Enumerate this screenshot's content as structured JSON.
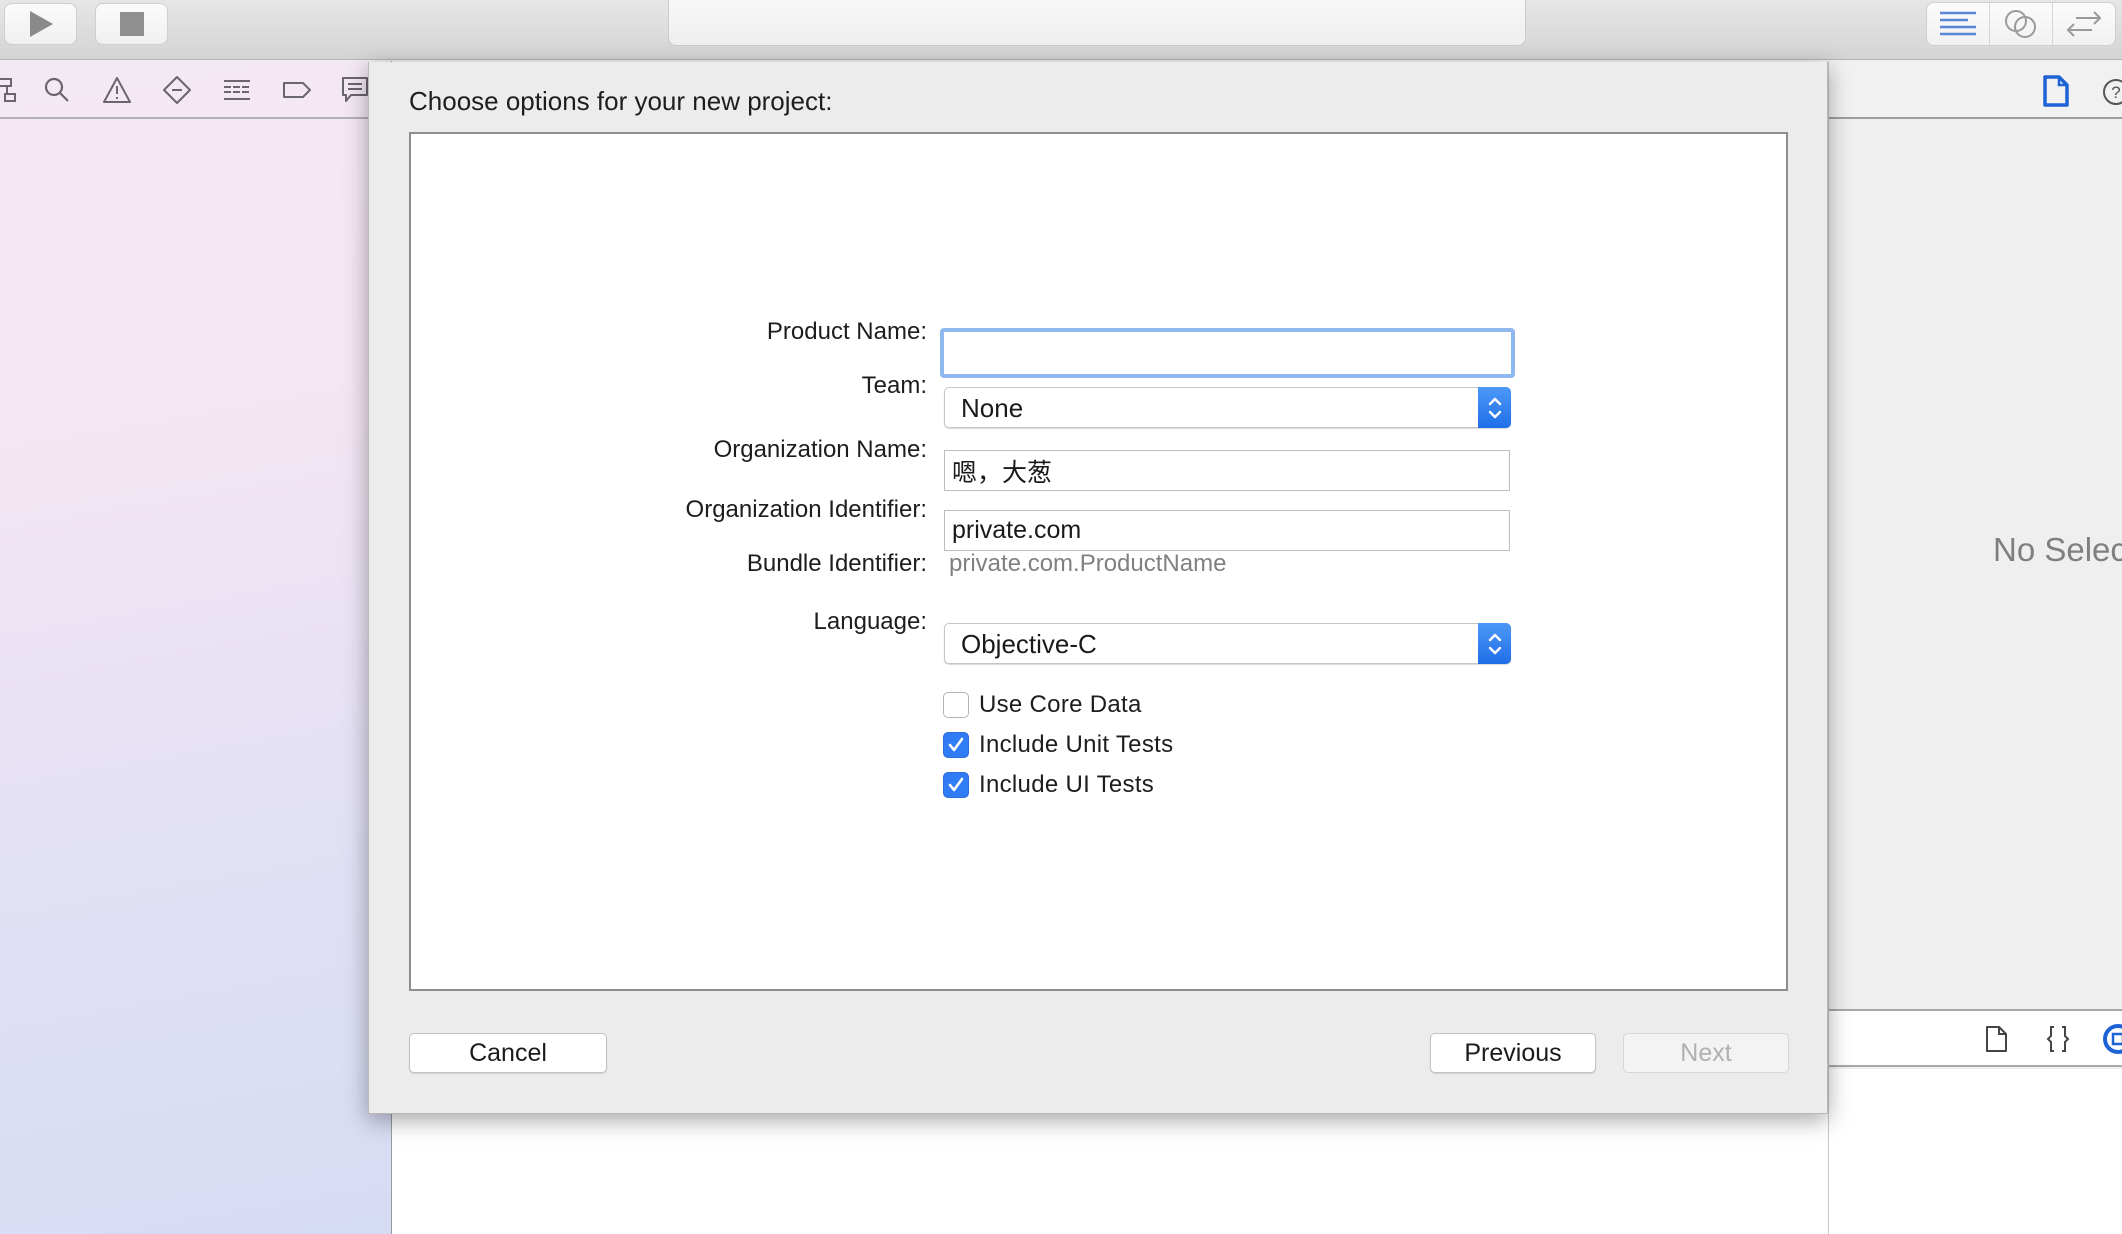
{
  "toolbar": {
    "run_icon": "play-icon",
    "stop_icon": "stop-icon",
    "activity_text": "",
    "editor_modes": [
      {
        "name": "standard-editor",
        "icon": "lines-icon",
        "active": true
      },
      {
        "name": "assistant-editor",
        "icon": "overlapping-circles-icon",
        "active": false
      },
      {
        "name": "version-editor",
        "icon": "arrows-left-right-icon",
        "active": false
      }
    ]
  },
  "navigator": {
    "icons": [
      "hierarchy-icon",
      "search-icon",
      "warning-icon",
      "breakpoint-diamond-icon",
      "list-icon",
      "tag-icon",
      "comment-icon"
    ]
  },
  "inspector": {
    "tabs": [
      "file-icon",
      "help-icon"
    ],
    "empty_text": "No Selection",
    "library_tabs": [
      "file-template-icon",
      "code-snippet-icon",
      "object-library-icon"
    ]
  },
  "dialog": {
    "title": "Choose options for your new project:",
    "fields": {
      "product_name": {
        "label": "Product Name:",
        "value": ""
      },
      "team": {
        "label": "Team:",
        "value": "None"
      },
      "organization_name": {
        "label": "Organization Name:",
        "value": "嗯，大葱"
      },
      "organization_identifier": {
        "label": "Organization Identifier:",
        "value": "private.com"
      },
      "bundle_identifier": {
        "label": "Bundle Identifier:",
        "value": "private.com.ProductName"
      },
      "language": {
        "label": "Language:",
        "value": "Objective-C"
      }
    },
    "checkboxes": [
      {
        "label": "Use Core Data",
        "checked": false
      },
      {
        "label": "Include Unit Tests",
        "checked": true
      },
      {
        "label": "Include UI Tests",
        "checked": true
      }
    ],
    "buttons": {
      "cancel": "Cancel",
      "previous": "Previous",
      "next": "Next"
    }
  },
  "colors": {
    "accent": "#2f7cf6",
    "focus_ring": "#8fb8f1",
    "disabled_text": "#b0b0b0"
  }
}
